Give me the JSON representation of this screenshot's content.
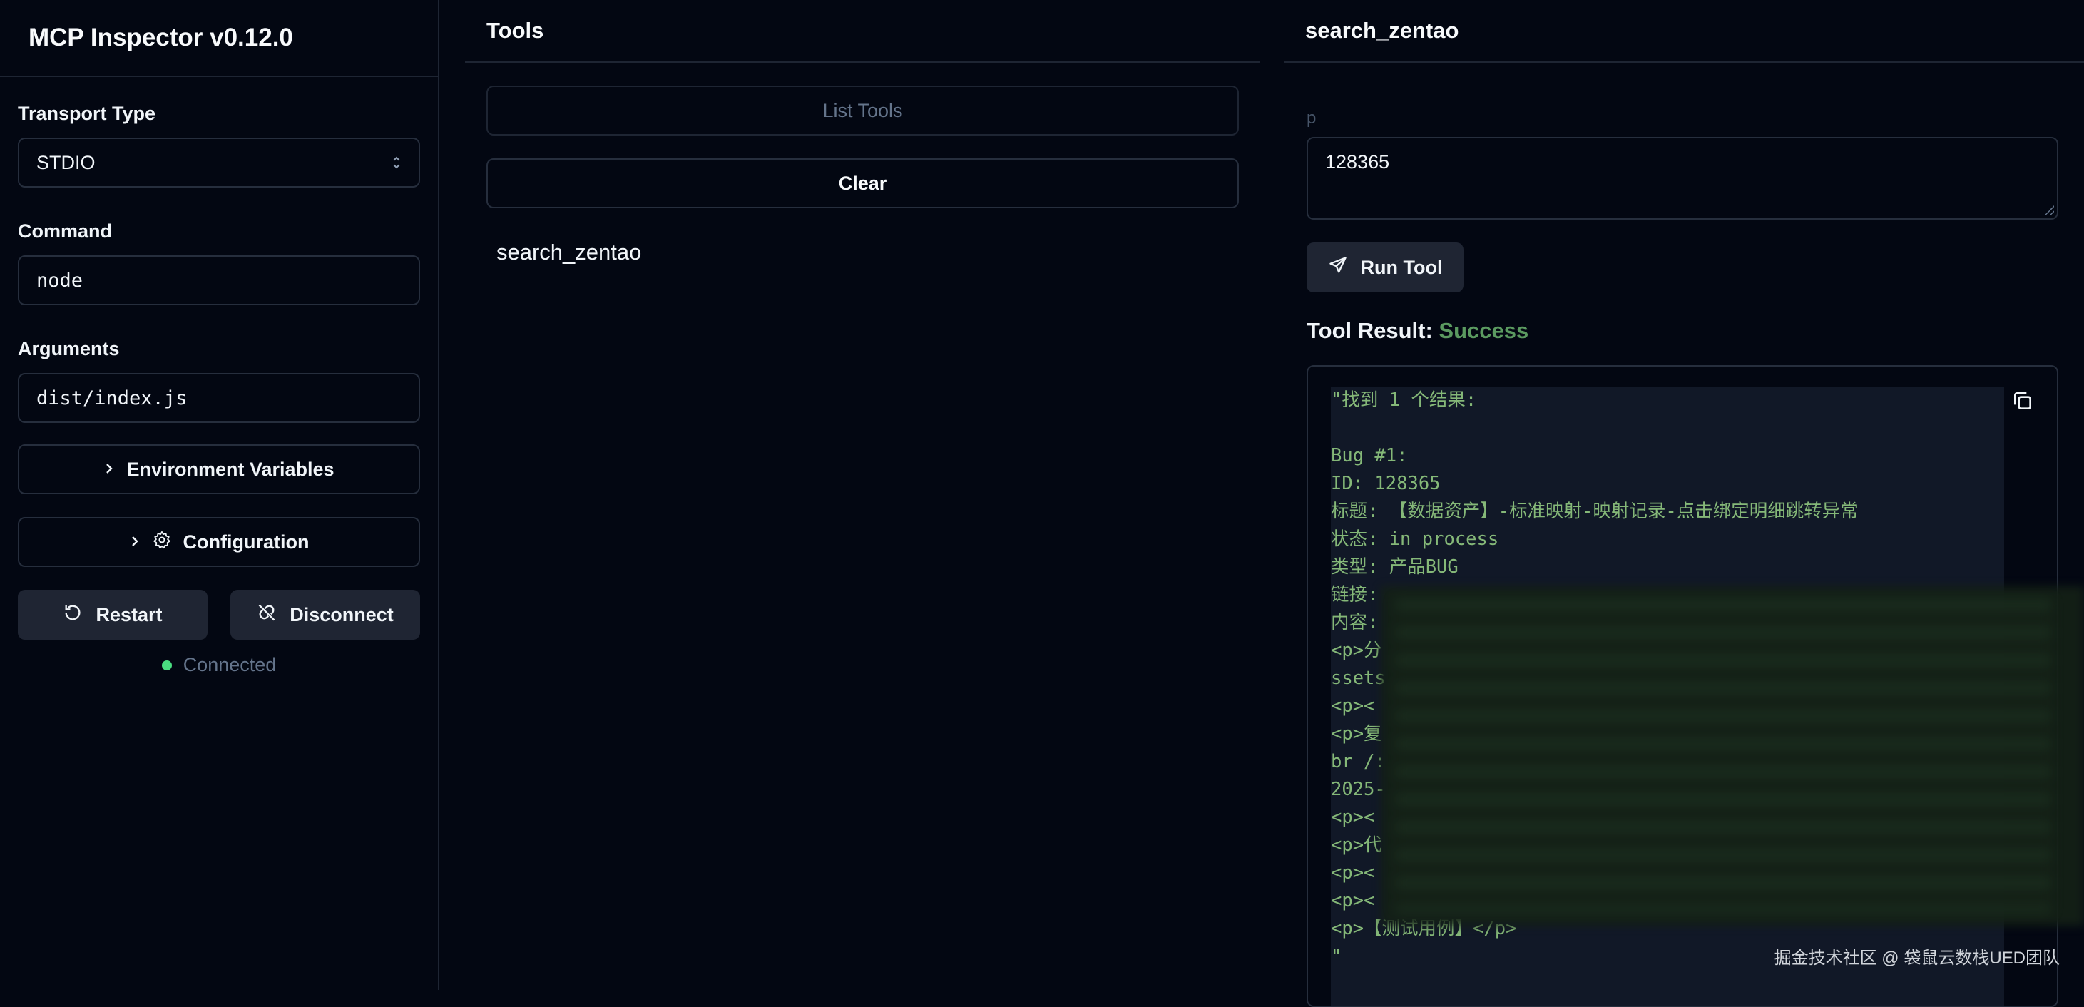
{
  "sidebar": {
    "title": "MCP Inspector v0.12.0",
    "transport_label": "Transport Type",
    "transport_value": "STDIO",
    "command_label": "Command",
    "command_value": "node",
    "arguments_label": "Arguments",
    "arguments_value": "dist/index.js",
    "env_label": "Environment Variables",
    "config_label": "Configuration",
    "restart_label": "Restart",
    "disconnect_label": "Disconnect",
    "status_label": "Connected"
  },
  "tools": {
    "header": "Tools",
    "list_label": "List Tools",
    "clear_label": "Clear",
    "items": [
      "search_zentao"
    ]
  },
  "detail": {
    "header": "search_zentao",
    "param_label": "p",
    "param_value": "128365",
    "run_label": "Run Tool",
    "result_prefix": "Tool Result:",
    "result_status": "Success",
    "result_lines": [
      "\"找到 1 个结果:",
      "",
      "Bug #1:",
      "ID: 128365",
      "标题: 【数据资产】-标准映射-映射记录-点击绑定明细跳转异常",
      "状态: in process",
      "类型: 产品BUG",
      "链接:",
      "内容:",
      "<p>分",
      "ssets",
      "<p><",
      "<p>复",
      "br /:",
      "2025-",
      "<p><",
      "<p>代",
      "<p><",
      "<p><",
      "<p>【测试用例】</p>",
      "\""
    ]
  },
  "watermark": "掘金技术社区 @ 袋鼠云数栈UED团队",
  "colors": {
    "background": "#030712",
    "success": "#5b9a60",
    "code_text": "#85b878",
    "status_dot": "#4ade80"
  }
}
